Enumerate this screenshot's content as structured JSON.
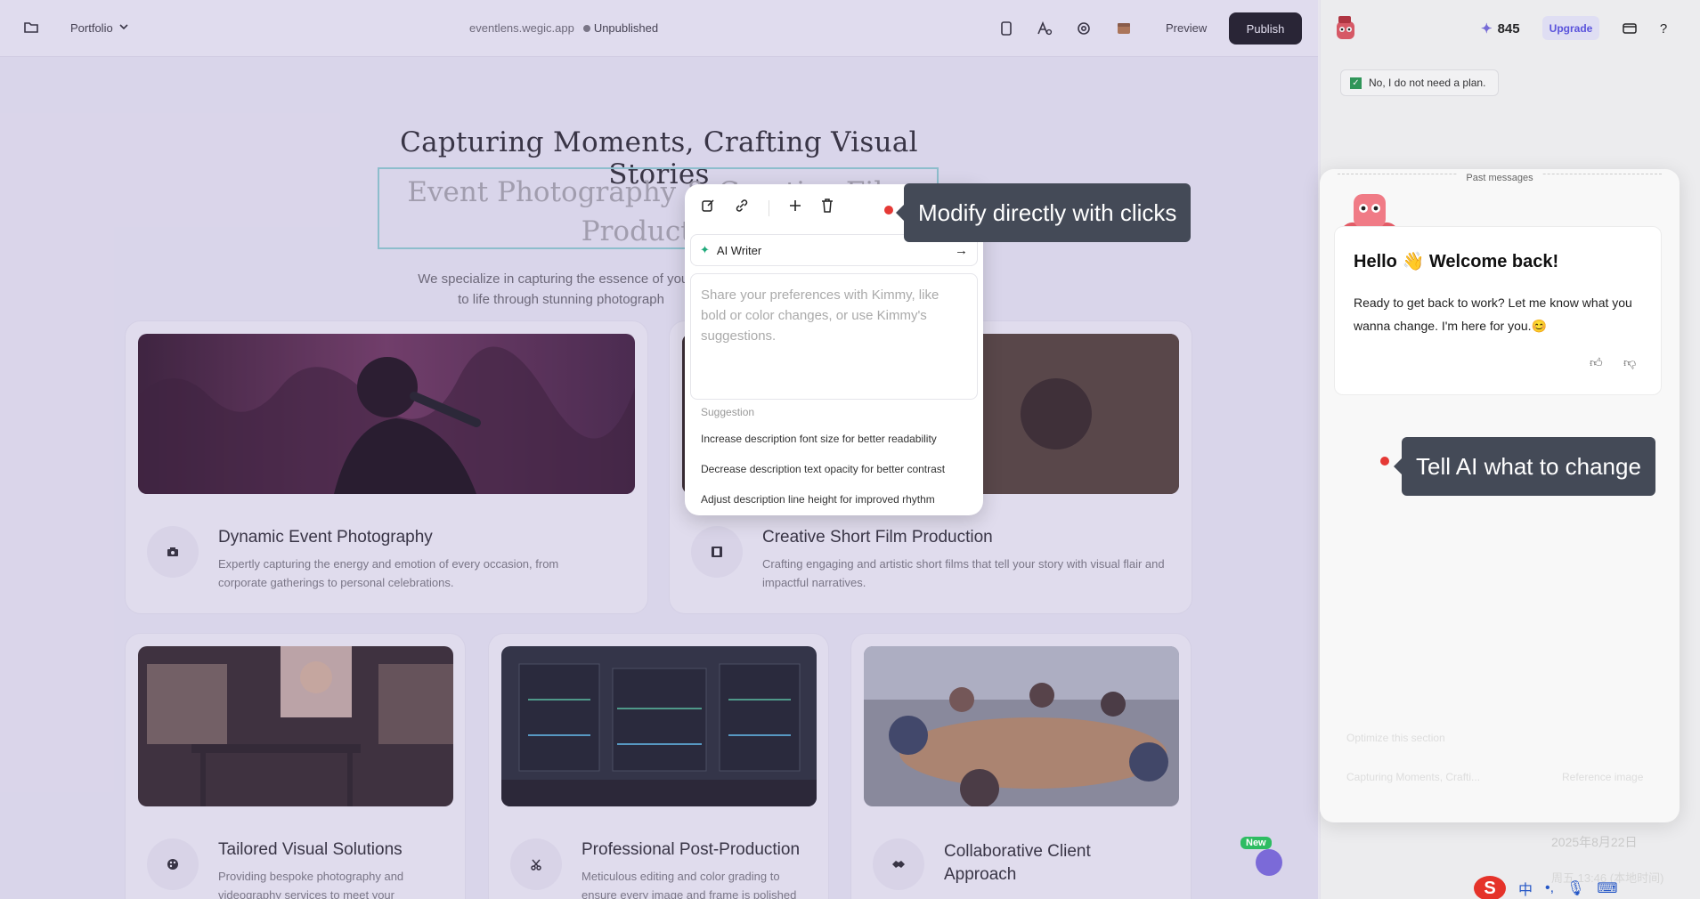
{
  "topbar": {
    "project": "Portfolio",
    "domain": "eventlens.wegic.app",
    "status": "Unpublished",
    "preview": "Preview",
    "publish": "Publish",
    "icons": [
      "folder-icon",
      "device-icon",
      "font-icon",
      "settings-icon",
      "box-icon"
    ]
  },
  "hero": {
    "title": "Capturing Moments, Crafting Visual Stories",
    "subtitle": "Event Photography & Creative Film Production",
    "description_left": "We specialize in capturing the essence of your e",
    "description_left_2": "to life through stunning photograph"
  },
  "cards": [
    {
      "title": "Dynamic Event Photography",
      "desc": "Expertly capturing the energy and emotion of every occasion, from corporate gatherings to personal celebrations.",
      "icon": "camera-icon"
    },
    {
      "title": "Creative Short Film Production",
      "desc": "Crafting engaging and artistic short films that tell your story with visual flair and impactful narratives.",
      "icon": "film-icon"
    },
    {
      "title": "Tailored Visual Solutions",
      "desc": "Providing bespoke photography and videography services to meet your",
      "icon": "palette-icon"
    },
    {
      "title": "Professional Post-Production",
      "desc": "Meticulous editing and color grading to ensure every image and frame is polished",
      "icon": "scissors-icon"
    },
    {
      "title": "Collaborative Client Approach",
      "desc": "",
      "icon": "handshake-icon"
    }
  ],
  "popup": {
    "ai_writer": "AI Writer",
    "placeholder": "Share your preferences with Kimmy, like bold or color changes, or use Kimmy's suggestions.",
    "suggestion_header": "Suggestion",
    "suggestions": [
      "Increase description font size for better readability",
      "Decrease description text opacity for better contrast",
      "Adjust description line height for improved rhythm"
    ]
  },
  "tooltips": {
    "modify": "Modify directly with clicks",
    "tell_ai": "Tell AI what to change"
  },
  "right_panel": {
    "credits": "845",
    "upgrade": "Upgrade",
    "chip": "No, I do not need a plan.",
    "past_messages": "Past messages",
    "hello": "Hello 👋 Welcome back!",
    "body": "Ready to get back to work? Let me know what you wanna change. I'm here for you.😊",
    "ghost_1": "Optimize this section",
    "ghost_2": "Capturing Moments, Crafti...",
    "ghost_3": "Reference image"
  },
  "system": {
    "date": "2025年8月22日",
    "time": "周五 13:46 (本地时间)",
    "new_badge": "New",
    "ime": "中"
  },
  "colors": {
    "overlay": "#8773be",
    "accent": "#5b53e6",
    "publish_bg": "#0d0d0d",
    "tooltip_bg": "#444a57",
    "red_dot": "#e53935"
  }
}
